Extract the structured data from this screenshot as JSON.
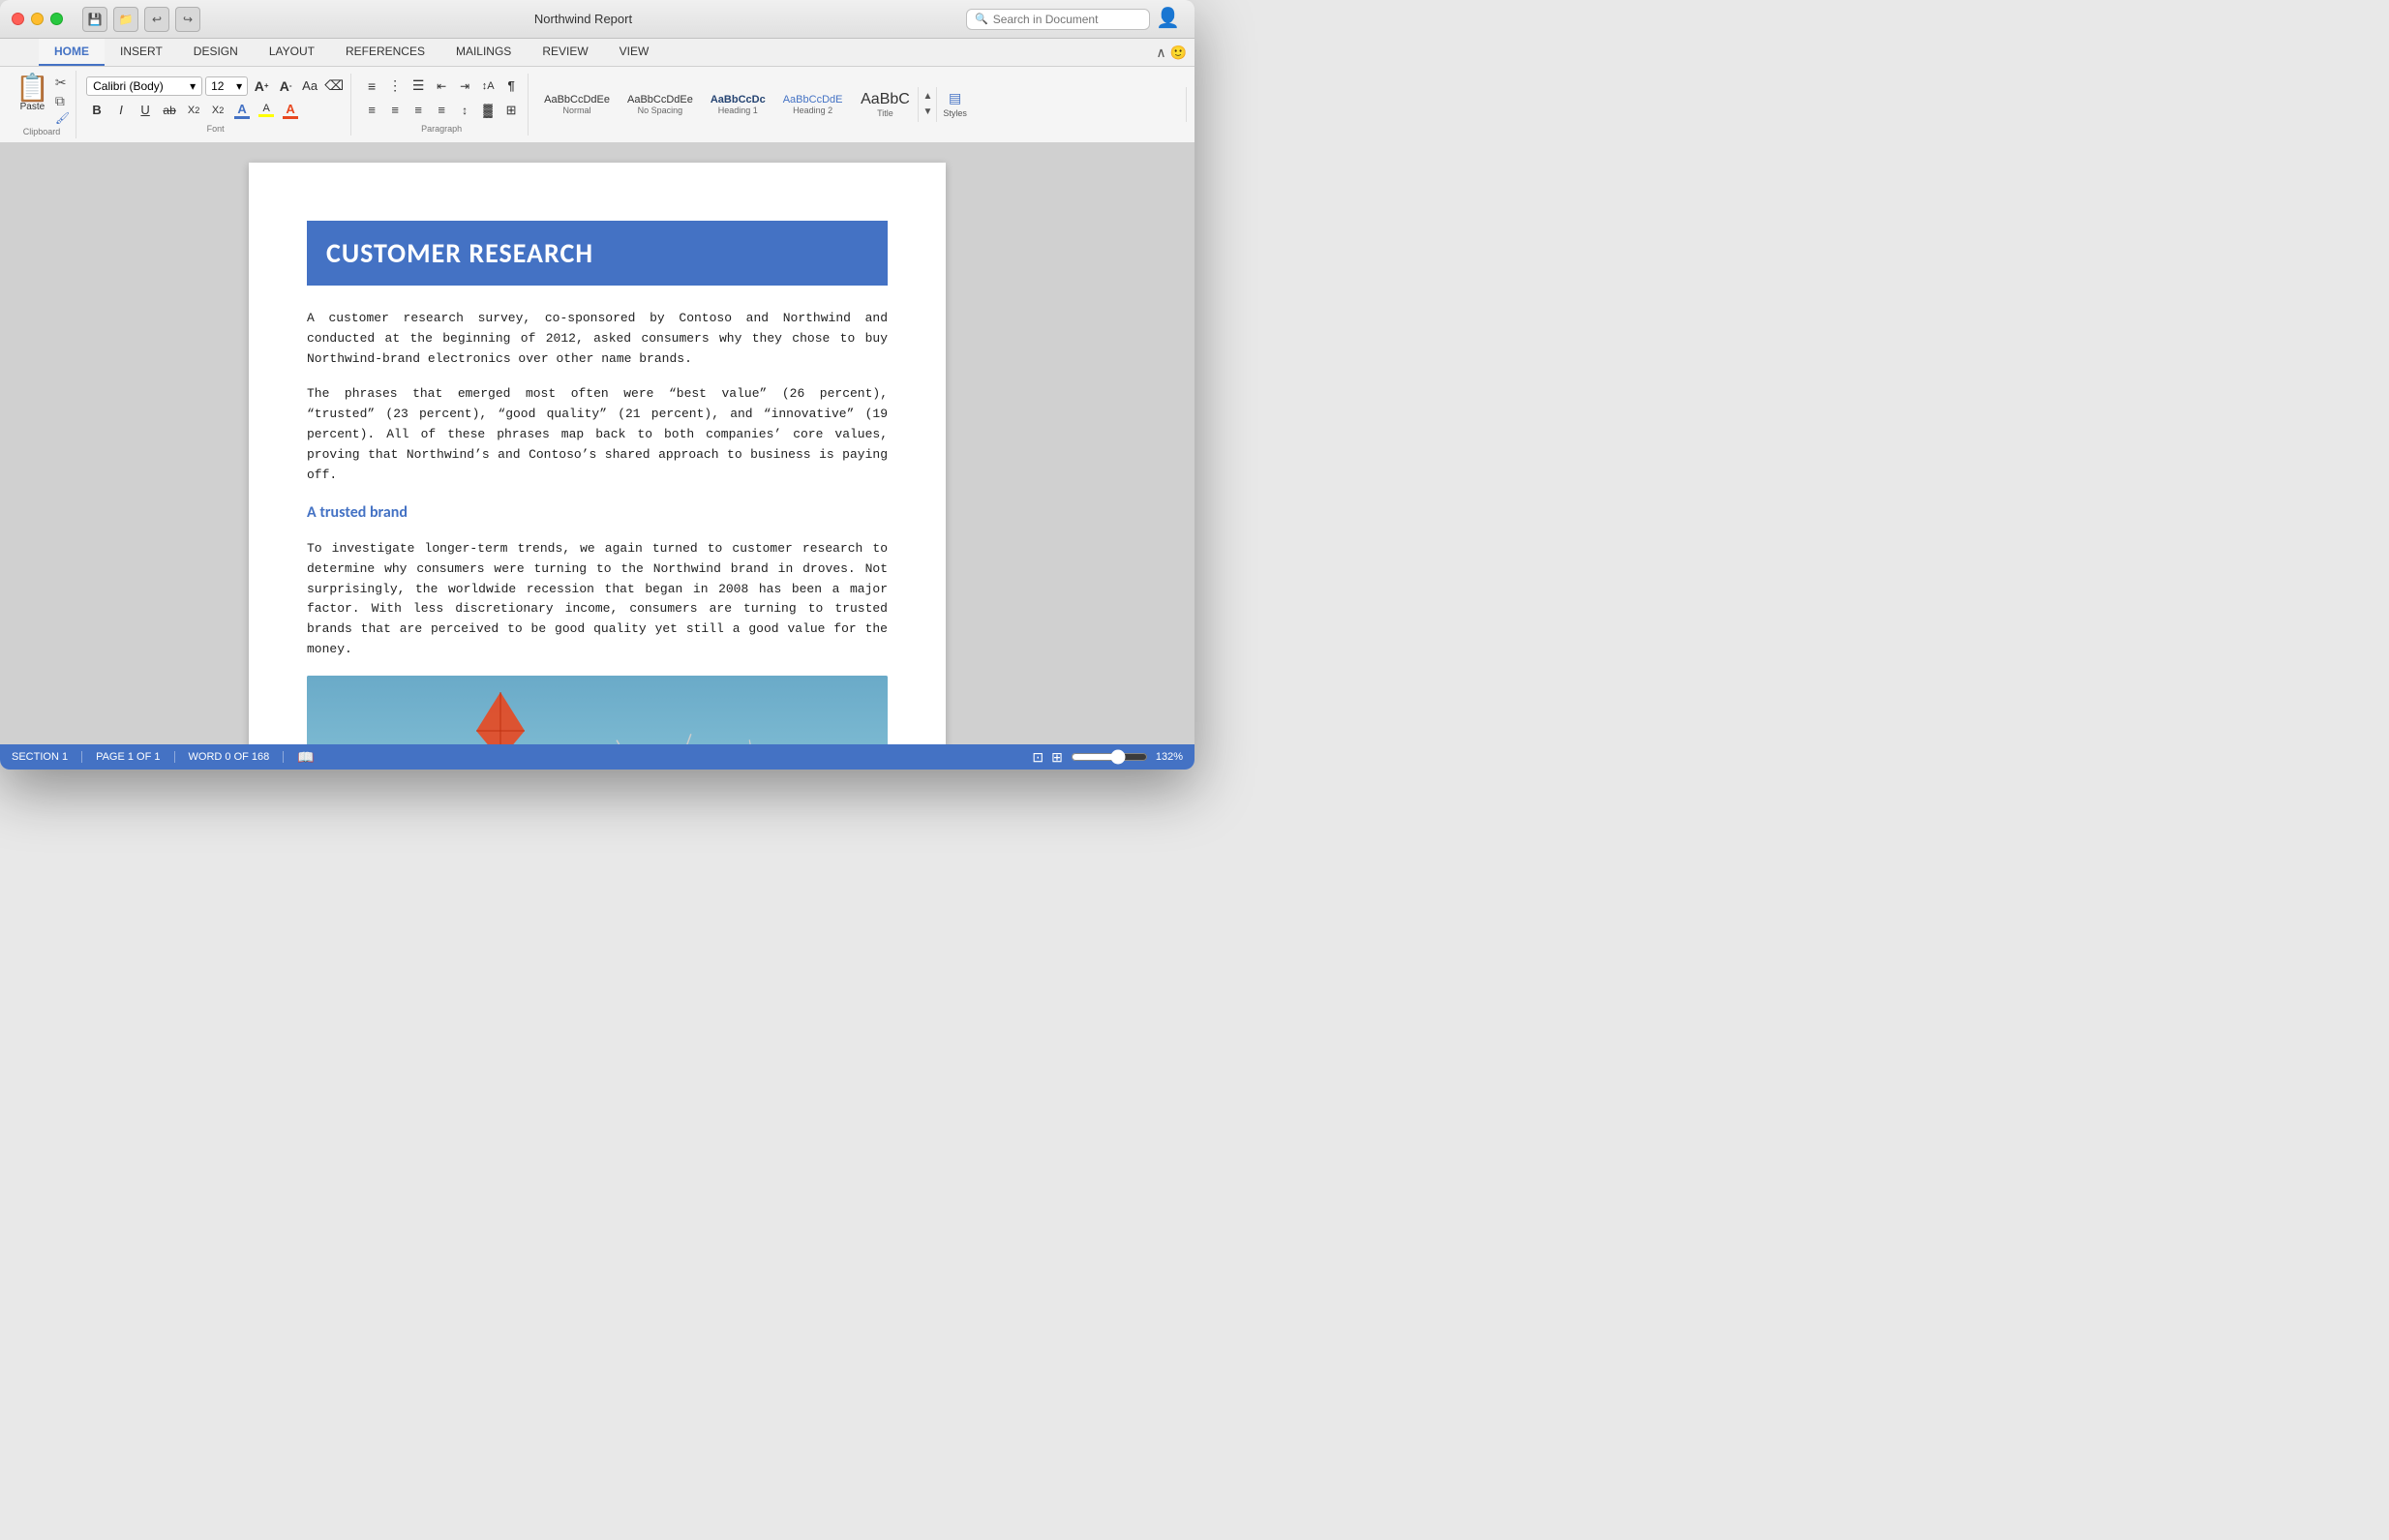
{
  "window": {
    "title": "Northwind Report",
    "traffic_lights": [
      "red",
      "yellow",
      "green"
    ]
  },
  "title_bar": {
    "title": "Northwind Report",
    "search_placeholder": "Search in Document",
    "tools": [
      "save",
      "open",
      "undo",
      "redo"
    ]
  },
  "ribbon": {
    "tabs": [
      {
        "id": "home",
        "label": "HOME",
        "active": true
      },
      {
        "id": "insert",
        "label": "INSERT",
        "active": false
      },
      {
        "id": "design",
        "label": "DESIGN",
        "active": false
      },
      {
        "id": "layout",
        "label": "LAYOUT",
        "active": false
      },
      {
        "id": "references",
        "label": "REFERENCES",
        "active": false
      },
      {
        "id": "mailings",
        "label": "MAILINGS",
        "active": false
      },
      {
        "id": "review",
        "label": "REVIEW",
        "active": false
      },
      {
        "id": "view",
        "label": "VIEW",
        "active": false
      }
    ],
    "clipboard": {
      "paste_label": "Paste"
    },
    "font": {
      "family": "Calibri (Body)",
      "size": "12"
    },
    "styles": [
      {
        "id": "normal",
        "preview": "AaBbCcDdEe",
        "label": "Normal",
        "active": false
      },
      {
        "id": "no-spacing",
        "preview": "AaBbCcDdEe",
        "label": "No Spacing",
        "active": false
      },
      {
        "id": "heading1",
        "preview": "AaBbCcDc",
        "label": "Heading 1",
        "active": false
      },
      {
        "id": "heading2",
        "preview": "AaBbCcDdE",
        "label": "Heading 2",
        "active": false
      },
      {
        "id": "title",
        "preview": "AaBbC",
        "label": "Title",
        "active": false
      }
    ],
    "styles_label": "Styles"
  },
  "document": {
    "title": "CUSTOMER RESEARCH",
    "paragraphs": [
      "A customer research survey, co-sponsored by Contoso and Northwind and conducted at the beginning of 2012, asked consumers why they chose to buy Northwind-brand electronics over other name brands.",
      "The phrases that emerged most often were “best value” (26 percent), “trusted” (23 percent), “good quality” (21 percent), and “innovative” (19 percent). All of these phrases map back to both companies’ core values, proving that Northwind’s and Contoso’s shared approach to business is paying off."
    ],
    "section_heading": "A trusted brand",
    "section_paragraph": "To investigate longer-term trends, we again turned to customer research to determine why consumers were turning to the Northwind brand in droves. Not surprisingly, the worldwide recession that began in 2008 has been a major factor. With less discretionary income, consumers are turning to trusted brands that are perceived to be good quality yet still a good value for the money."
  },
  "status_bar": {
    "section": "SECTION 1",
    "page": "PAGE 1 OF 1",
    "words": "WORD 0 OF 168",
    "zoom": "132%"
  }
}
